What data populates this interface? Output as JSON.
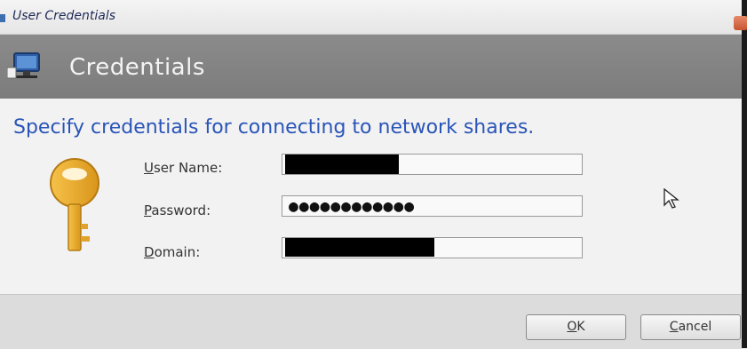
{
  "window": {
    "title": "User Credentials"
  },
  "header": {
    "title": "Credentials",
    "icon": "network-computer-icon"
  },
  "main": {
    "instruction": "Specify credentials for connecting to network shares.",
    "icon": "key-icon",
    "fields": {
      "username": {
        "label_mnemonic": "U",
        "label_rest": "ser Name:",
        "value_redacted": true
      },
      "password": {
        "label_mnemonic": "P",
        "label_rest": "assword:",
        "masked_value": "●●●●●●●●●●●●"
      },
      "domain": {
        "label_mnemonic": "D",
        "label_rest": "omain:",
        "value_redacted": true
      }
    }
  },
  "footer": {
    "ok": {
      "mnemonic": "O",
      "rest": "K"
    },
    "cancel": {
      "mnemonic": "C",
      "rest": "ancel"
    }
  },
  "colors": {
    "accent_text": "#2a55b8",
    "header_bg": "#838383",
    "close_button": "#d0603a"
  }
}
